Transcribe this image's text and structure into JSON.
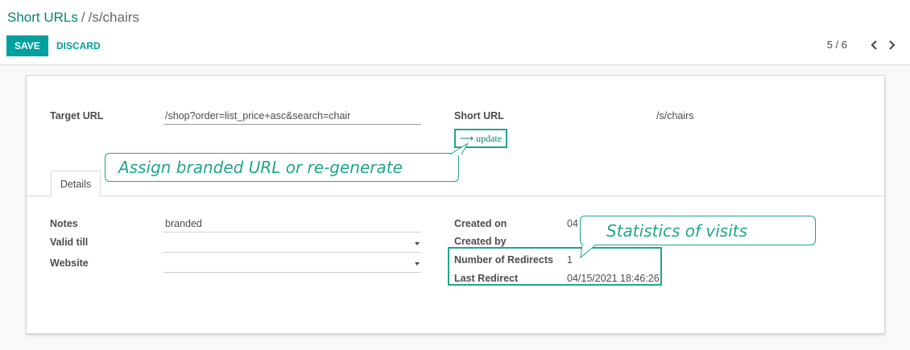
{
  "breadcrumb": {
    "parent": "Short URLs",
    "separator": "/",
    "current": "/s/chairs"
  },
  "toolbar": {
    "save_label": "SAVE",
    "discard_label": "DISCARD"
  },
  "pager": {
    "value": "5 / 6",
    "prev_icon": "chevron-left-icon",
    "next_icon": "chevron-right-icon"
  },
  "form": {
    "target_url_label": "Target URL",
    "target_url_value": "/shop?order=list_price+asc&search=chair",
    "short_url_label": "Short URL",
    "short_url_value": "/s/chairs",
    "update_label": "update",
    "update_icon": "arrow-right-icon"
  },
  "tabs": [
    {
      "label": "Details"
    }
  ],
  "details": {
    "notes_label": "Notes",
    "notes_value": "branded",
    "valid_till_label": "Valid till",
    "valid_till_value": "",
    "website_label": "Website",
    "website_value": "",
    "created_on_label": "Created on",
    "created_on_value": "04",
    "created_by_label": "Created by",
    "created_by_value": "",
    "redirects_label": "Number of Redirects",
    "redirects_value": "1",
    "last_redirect_label": "Last Redirect",
    "last_redirect_value": "04/15/2021 18:46:26"
  },
  "callouts": {
    "assign": "Assign branded URL or re-generate",
    "stats": "Statistics of visits"
  },
  "colors": {
    "accent": "#00a09d",
    "highlight": "#20a58e",
    "link": "#018576"
  }
}
